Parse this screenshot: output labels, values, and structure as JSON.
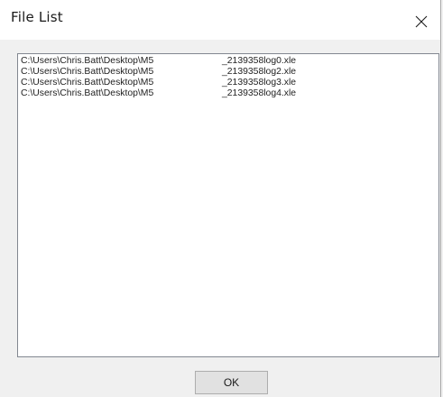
{
  "window": {
    "title": "File List"
  },
  "file_list": {
    "items": [
      {
        "path": "C:\\Users\\Chris.Batt\\Desktop\\M5",
        "name": "_2139358log0.xle"
      },
      {
        "path": "C:\\Users\\Chris.Batt\\Desktop\\M5",
        "name": "_2139358log2.xle"
      },
      {
        "path": "C:\\Users\\Chris.Batt\\Desktop\\M5",
        "name": "_2139358log3.xle"
      },
      {
        "path": "C:\\Users\\Chris.Batt\\Desktop\\M5",
        "name": "_2139358log4.xle"
      }
    ]
  },
  "buttons": {
    "ok_label": "OK"
  },
  "icons": {
    "close": "close-icon"
  },
  "colors": {
    "title_bar_bg": "#ffffff",
    "dialog_bg": "#f0f0f0",
    "list_border": "#828790",
    "button_bg": "#e1e1e1",
    "button_border": "#adadad"
  }
}
